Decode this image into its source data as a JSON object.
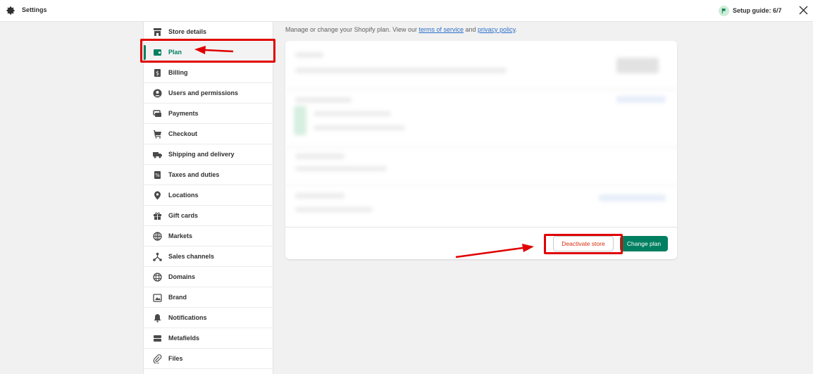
{
  "topbar": {
    "title": "Settings",
    "setup_guide": "Setup guide: 6/7"
  },
  "sidebar": {
    "items": [
      {
        "label": "Store details",
        "icon": "store-icon"
      },
      {
        "label": "Plan",
        "icon": "plan-icon",
        "active": true
      },
      {
        "label": "Billing",
        "icon": "billing-icon"
      },
      {
        "label": "Users and permissions",
        "icon": "user-icon"
      },
      {
        "label": "Payments",
        "icon": "payments-icon"
      },
      {
        "label": "Checkout",
        "icon": "cart-icon"
      },
      {
        "label": "Shipping and delivery",
        "icon": "truck-icon"
      },
      {
        "label": "Taxes and duties",
        "icon": "tax-icon"
      },
      {
        "label": "Locations",
        "icon": "location-pin-icon"
      },
      {
        "label": "Gift cards",
        "icon": "gift-icon"
      },
      {
        "label": "Markets",
        "icon": "globe-markets-icon"
      },
      {
        "label": "Sales channels",
        "icon": "sales-channels-icon"
      },
      {
        "label": "Domains",
        "icon": "globe-icon"
      },
      {
        "label": "Brand",
        "icon": "brand-icon"
      },
      {
        "label": "Notifications",
        "icon": "bell-icon"
      },
      {
        "label": "Metafields",
        "icon": "metafields-icon"
      },
      {
        "label": "Files",
        "icon": "paperclip-icon"
      }
    ]
  },
  "main": {
    "intro_text": "Manage or change your Shopify plan. View our",
    "terms_link": "terms of service",
    "and_text": "and",
    "privacy_link": "privacy policy",
    "period": ".",
    "deactivate_label": "Deactivate store",
    "change_plan_label": "Change plan"
  },
  "colors": {
    "brand_green": "#008060",
    "annotation_red": "#e00000",
    "link_blue": "#2c6ecb",
    "critical_red": "#d82c0d"
  }
}
